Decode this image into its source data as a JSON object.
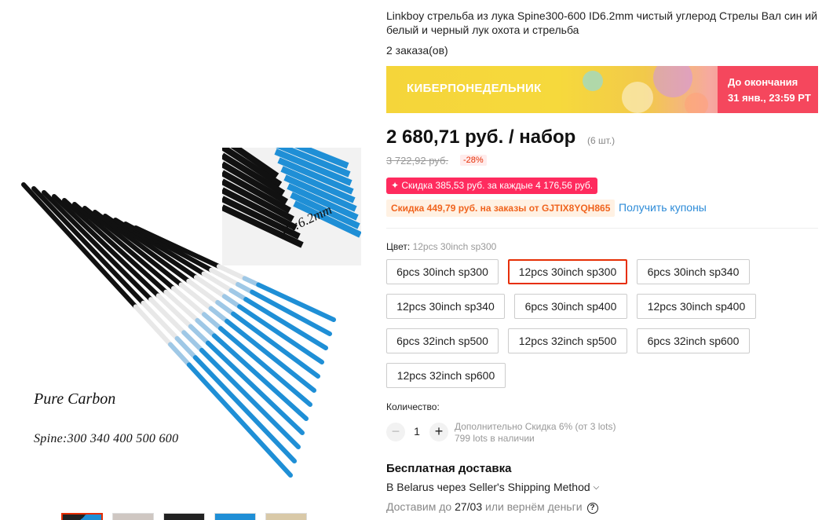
{
  "product": {
    "title": "Linkboy стрельба из лука Spine300-600 ID6.2mm чистый углерод Стрелы Вал син ий белый и черный лук охота и стрельба",
    "orders": "2 заказа(ов)",
    "image_caption_1": "Pure Carbon",
    "image_caption_2": "Spine:300 340 400 500 600",
    "inset_caption": "ID:6.2mm"
  },
  "banner": {
    "title": "КИБЕРПОНЕДЕЛЬНИК",
    "countdown_line1": "До окончания",
    "countdown_line2": "31 янв., 23:59 PT"
  },
  "price": {
    "current": "2 680,71 руб. / набор",
    "unit": "(6 шт.)",
    "old": "3 722,92 руб.",
    "discount": "-28%"
  },
  "promos": {
    "store_discount": "✦ Скидка 385,53 руб. за каждые 4 176,56 руб.",
    "coupon_code": "Скидка 449,79 руб. на заказы от GJTIX8YQH865",
    "coupon_link": "Получить купоны"
  },
  "color": {
    "label": "Цвет:",
    "selected": "12pcs 30inch sp300",
    "options": [
      "6pcs 30inch sp300",
      "12pcs 30inch sp300",
      "6pcs 30inch sp340",
      "12pcs 30inch sp340",
      "6pcs 30inch sp400",
      "12pcs 30inch sp400",
      "6pcs 32inch sp500",
      "12pcs 32inch sp500",
      "6pcs 32inch sp600",
      "12pcs 32inch sp600"
    ],
    "selected_index": 1
  },
  "quantity": {
    "label": "Количество:",
    "value": "1",
    "minus": "−",
    "plus": "+",
    "extra_discount": "Дополнительно Скидка 6% (от 3 lots)",
    "stock": "799 lots в наличии"
  },
  "shipping": {
    "title": "Бесплатная доставка",
    "method": "В Belarus через Seller's Shipping Method",
    "delivery_prefix": "Доставим до",
    "delivery_date": "27/03",
    "delivery_suffix": "или вернём деньги"
  },
  "colors": {
    "accent": "#e62e04",
    "promo_pink": "#ff2b5e",
    "link_blue": "#2c8bd8",
    "shaft_blue": "#1f8fd6"
  },
  "icons": {
    "chevron": "chevron-down-icon",
    "help": "help-icon"
  }
}
